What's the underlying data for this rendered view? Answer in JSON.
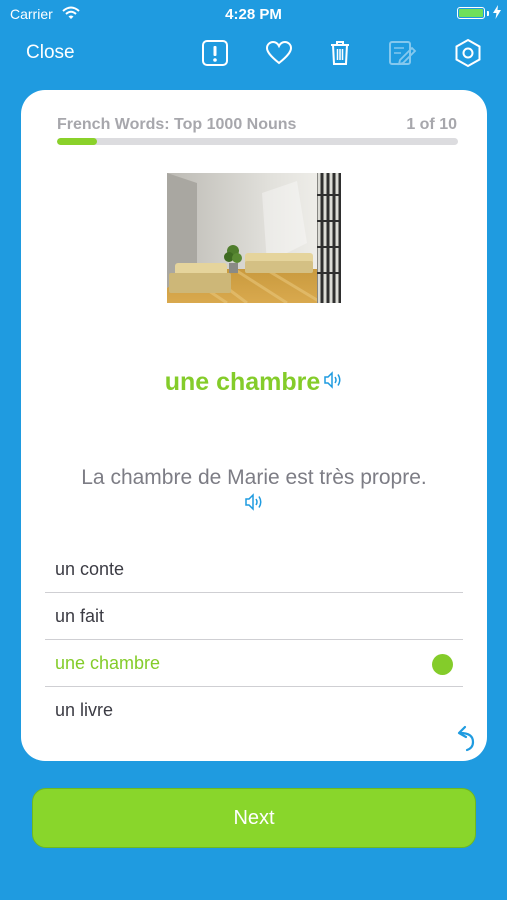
{
  "status_bar": {
    "carrier": "Carrier",
    "time": "4:28 PM"
  },
  "toolbar": {
    "close_label": "Close",
    "icons": [
      "report-icon",
      "heart-icon",
      "trash-icon",
      "edit-icon",
      "settings-icon"
    ]
  },
  "card": {
    "deck_title": "French Words: Top 1000 Nouns",
    "count": "1 of 10",
    "progress": 0.1,
    "word": "une chambre",
    "sentence": "La chambre de Marie est très propre.",
    "options": [
      {
        "label": "un conte",
        "selected": false
      },
      {
        "label": "un fait",
        "selected": false
      },
      {
        "label": "une chambre",
        "selected": true
      },
      {
        "label": "un livre",
        "selected": false
      }
    ]
  },
  "next_label": "Next",
  "colors": {
    "background": "#1f9be0",
    "accent_green": "#84cc2a",
    "button_green": "#89d62b"
  }
}
